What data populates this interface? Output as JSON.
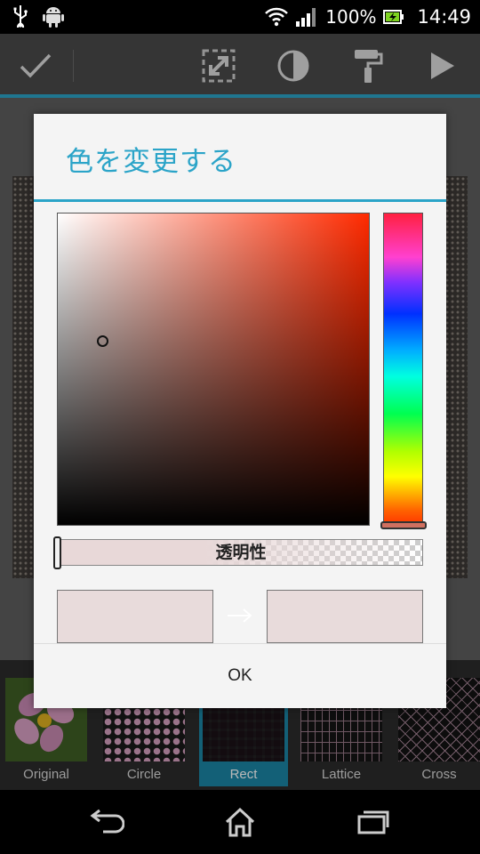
{
  "status_bar": {
    "battery": "100%",
    "time": "14:49",
    "icons": [
      "usb-icon",
      "android-icon",
      "wifi-icon",
      "signal-icon",
      "battery-icon"
    ]
  },
  "action_bar": {
    "buttons": [
      "check-icon",
      "resize-icon",
      "contrast-icon",
      "paint-roller-icon",
      "play-icon"
    ]
  },
  "dialog": {
    "title": "色を変更する",
    "alpha_label": "透明性",
    "ok_label": "OK",
    "old_color": "#e8dbdb",
    "new_color": "#e8dbdb",
    "hue_color": "#ff2a00",
    "accent": "#2ba4c8"
  },
  "filters": [
    {
      "label": "Original",
      "selected": false
    },
    {
      "label": "Circle",
      "selected": false
    },
    {
      "label": "Rect",
      "selected": true
    },
    {
      "label": "Lattice",
      "selected": false
    },
    {
      "label": "Cross",
      "selected": false
    }
  ],
  "nav_bar": {
    "buttons": [
      "back-icon",
      "home-icon",
      "recent-apps-icon"
    ]
  }
}
